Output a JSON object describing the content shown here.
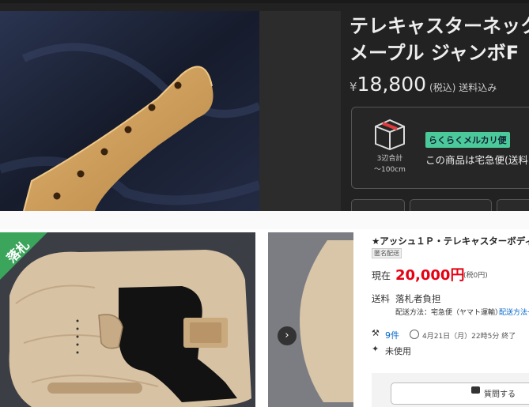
{
  "mercari": {
    "title_line1": "テレキャスターネック",
    "title_line2": "メープル ジャンボF",
    "currency": "¥",
    "price": "18,800",
    "tax_note": "(税込) 送料込み",
    "size_label": "3辺合計",
    "size_value": "〜100cm",
    "badge": "らくらくメルカリ便",
    "ship_text": "この商品は宅急便(送料",
    "colors": {
      "badge": "#4bc99a",
      "bg": "#222222"
    }
  },
  "auction": {
    "ribbon": "落札",
    "title": "★アッシュ１Ｐ・テレキャスターボディ",
    "anon_badge": "匿名配送",
    "current_label": "現在",
    "current_price": "20,000円",
    "tax_note": "(税0円)",
    "shipping_label": "送料",
    "shipping_value": "落札者負担",
    "method": "配送方法：宅急便（ヤマト運輸）",
    "method_link": "配送方法一",
    "bids": "9件",
    "end_time": "4月21日（月）22時5分 終了",
    "condition": "未使用",
    "question_button": "質問する",
    "colors": {
      "price": "#e60012",
      "link": "#0066cc",
      "ribbon": "#3ba55c"
    }
  }
}
